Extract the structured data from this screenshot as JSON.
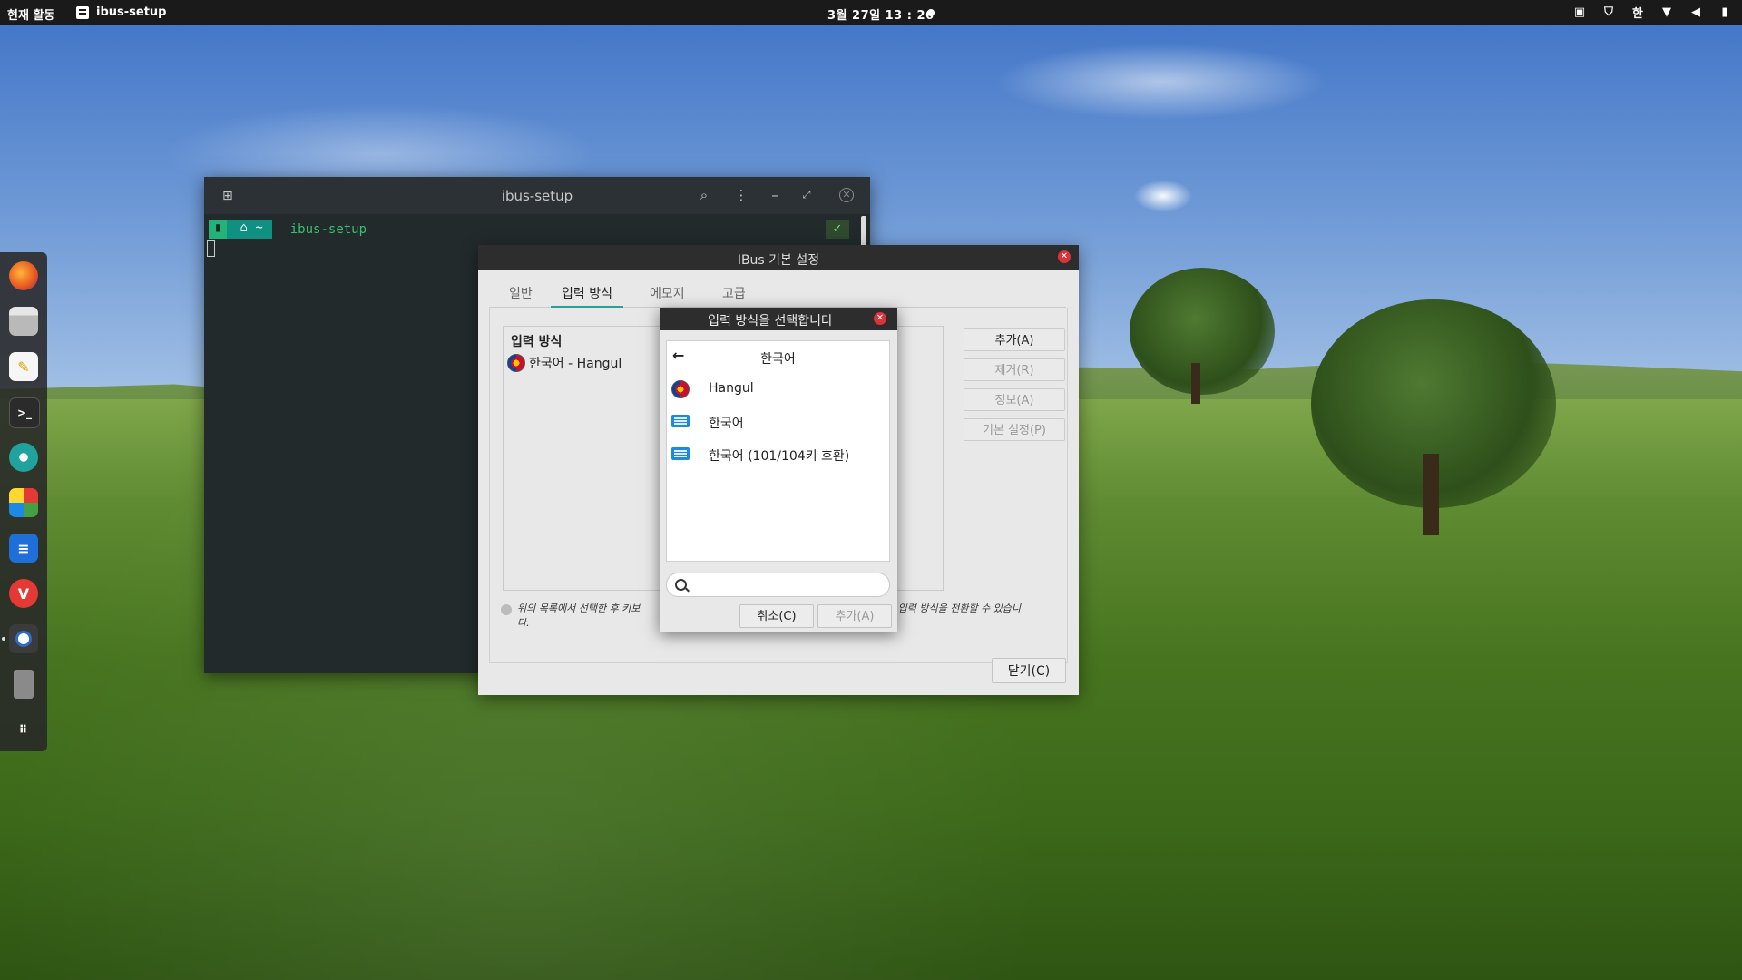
{
  "topbar": {
    "activities": "현재 활동",
    "app_name": "ibus-setup",
    "clock": "3월 27일  13 : 26",
    "input_indicator": "한"
  },
  "terminal": {
    "title": "ibus-setup",
    "prompt_dir": "~",
    "command": "ibus-setup",
    "status_check": "✓"
  },
  "prefs": {
    "title": "IBus 기본 설정",
    "tabs": [
      "일반",
      "입력 방식",
      "에모지",
      "고급"
    ],
    "active_tab": "입력 방식",
    "list_title": "입력 방식",
    "input_methods": [
      {
        "label": "한국어 - Hangul"
      }
    ],
    "buttons": {
      "add": "추가(A)",
      "remove": "제거(R)",
      "about": "정보(A)",
      "preferences": "기본 설정(P)",
      "close": "닫기(C)"
    },
    "info_text_left": "위의 목록에서 선택한 후 키보",
    "info_text_right": "성 입력 방식을 전환할 수 있습니",
    "info_text_wrap": "다."
  },
  "chooser": {
    "title": "입력 방식을 선택합니다",
    "header": "한국어",
    "items": [
      {
        "label": "Hangul",
        "icon": "taeguk-icon"
      },
      {
        "label": "한국어",
        "icon": "keyboard-icon"
      },
      {
        "label": "한국어 (101/104키 호환)",
        "icon": "keyboard-icon"
      }
    ],
    "search_placeholder": "",
    "cancel": "취소(C)",
    "add": "추가(A)"
  },
  "colors": {
    "accent": "#2aa198",
    "close_red": "#d8343a",
    "terminal_bg": "#222a2c",
    "prompt_green": "#23b37a"
  }
}
